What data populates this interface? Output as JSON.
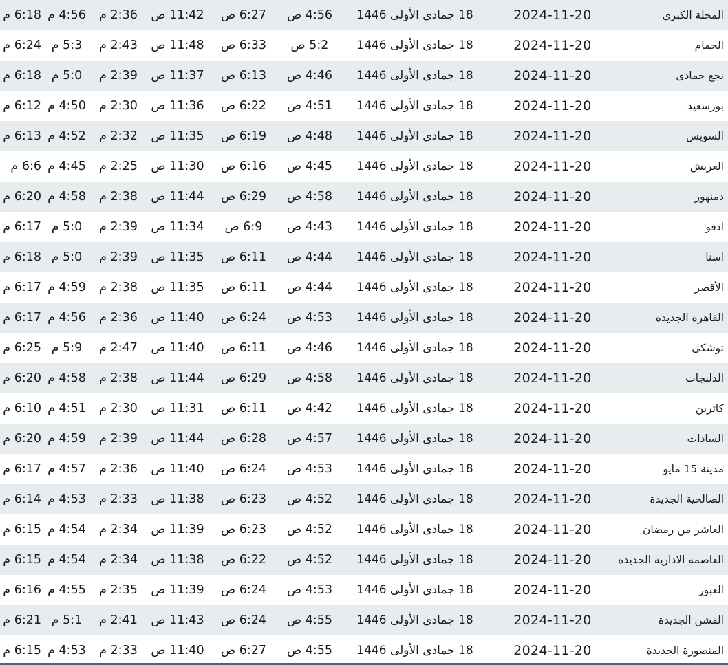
{
  "rows": [
    {
      "city": "المحلة الكبرى",
      "gregorian": "2024-11-20",
      "hijri": "18 جمادى الأولى 1446",
      "fajr": "4:56 ص",
      "sunrise": "6:27 ص",
      "dhuhr": "11:42 ص",
      "asr": "2:36 م",
      "maghrib": "4:56 م",
      "isha": "6:18 م"
    },
    {
      "city": "الحمام",
      "gregorian": "2024-11-20",
      "hijri": "18 جمادى الأولى 1446",
      "fajr": "5:2 ص",
      "sunrise": "6:33 ص",
      "dhuhr": "11:48 ص",
      "asr": "2:43 م",
      "maghrib": "5:3 م",
      "isha": "6:24 م"
    },
    {
      "city": "نجع حمادى",
      "gregorian": "2024-11-20",
      "hijri": "18 جمادى الأولى 1446",
      "fajr": "4:46 ص",
      "sunrise": "6:13 ص",
      "dhuhr": "11:37 ص",
      "asr": "2:39 م",
      "maghrib": "5:0 م",
      "isha": "6:18 م"
    },
    {
      "city": "بورسعيد",
      "gregorian": "2024-11-20",
      "hijri": "18 جمادى الأولى 1446",
      "fajr": "4:51 ص",
      "sunrise": "6:22 ص",
      "dhuhr": "11:36 ص",
      "asr": "2:30 م",
      "maghrib": "4:50 م",
      "isha": "6:12 م"
    },
    {
      "city": "السويس",
      "gregorian": "2024-11-20",
      "hijri": "18 جمادى الأولى 1446",
      "fajr": "4:48 ص",
      "sunrise": "6:19 ص",
      "dhuhr": "11:35 ص",
      "asr": "2:32 م",
      "maghrib": "4:52 م",
      "isha": "6:13 م"
    },
    {
      "city": "العريش",
      "gregorian": "2024-11-20",
      "hijri": "18 جمادى الأولى 1446",
      "fajr": "4:45 ص",
      "sunrise": "6:16 ص",
      "dhuhr": "11:30 ص",
      "asr": "2:25 م",
      "maghrib": "4:45 م",
      "isha": "6:6 م"
    },
    {
      "city": "دمنهور",
      "gregorian": "2024-11-20",
      "hijri": "18 جمادى الأولى 1446",
      "fajr": "4:58 ص",
      "sunrise": "6:29 ص",
      "dhuhr": "11:44 ص",
      "asr": "2:38 م",
      "maghrib": "4:58 م",
      "isha": "6:20 م"
    },
    {
      "city": "ادفو",
      "gregorian": "2024-11-20",
      "hijri": "18 جمادى الأولى 1446",
      "fajr": "4:43 ص",
      "sunrise": "6:9 ص",
      "dhuhr": "11:34 ص",
      "asr": "2:39 م",
      "maghrib": "5:0 م",
      "isha": "6:17 م"
    },
    {
      "city": "اسنا",
      "gregorian": "2024-11-20",
      "hijri": "18 جمادى الأولى 1446",
      "fajr": "4:44 ص",
      "sunrise": "6:11 ص",
      "dhuhr": "11:35 ص",
      "asr": "2:39 م",
      "maghrib": "5:0 م",
      "isha": "6:18 م"
    },
    {
      "city": "الأقصر",
      "gregorian": "2024-11-20",
      "hijri": "18 جمادى الأولى 1446",
      "fajr": "4:44 ص",
      "sunrise": "6:11 ص",
      "dhuhr": "11:35 ص",
      "asr": "2:38 م",
      "maghrib": "4:59 م",
      "isha": "6:17 م"
    },
    {
      "city": "القاهرة الجديدة",
      "gregorian": "2024-11-20",
      "hijri": "18 جمادى الأولى 1446",
      "fajr": "4:53 ص",
      "sunrise": "6:24 ص",
      "dhuhr": "11:40 ص",
      "asr": "2:36 م",
      "maghrib": "4:56 م",
      "isha": "6:17 م"
    },
    {
      "city": "توشكى",
      "gregorian": "2024-11-20",
      "hijri": "18 جمادى الأولى 1446",
      "fajr": "4:46 ص",
      "sunrise": "6:11 ص",
      "dhuhr": "11:40 ص",
      "asr": "2:47 م",
      "maghrib": "5:9 م",
      "isha": "6:25 م"
    },
    {
      "city": "الدلنجات",
      "gregorian": "2024-11-20",
      "hijri": "18 جمادى الأولى 1446",
      "fajr": "4:58 ص",
      "sunrise": "6:29 ص",
      "dhuhr": "11:44 ص",
      "asr": "2:38 م",
      "maghrib": "4:58 م",
      "isha": "6:20 م"
    },
    {
      "city": "كاترين",
      "gregorian": "2024-11-20",
      "hijri": "18 جمادى الأولى 1446",
      "fajr": "4:42 ص",
      "sunrise": "6:11 ص",
      "dhuhr": "11:31 ص",
      "asr": "2:30 م",
      "maghrib": "4:51 م",
      "isha": "6:10 م"
    },
    {
      "city": "السادات",
      "gregorian": "2024-11-20",
      "hijri": "18 جمادى الأولى 1446",
      "fajr": "4:57 ص",
      "sunrise": "6:28 ص",
      "dhuhr": "11:44 ص",
      "asr": "2:39 م",
      "maghrib": "4:59 م",
      "isha": "6:20 م"
    },
    {
      "city": "مدينة 15 مايو",
      "gregorian": "2024-11-20",
      "hijri": "18 جمادى الأولى 1446",
      "fajr": "4:53 ص",
      "sunrise": "6:24 ص",
      "dhuhr": "11:40 ص",
      "asr": "2:36 م",
      "maghrib": "4:57 م",
      "isha": "6:17 م"
    },
    {
      "city": "الصالحية الجديدة",
      "gregorian": "2024-11-20",
      "hijri": "18 جمادى الأولى 1446",
      "fajr": "4:52 ص",
      "sunrise": "6:23 ص",
      "dhuhr": "11:38 ص",
      "asr": "2:33 م",
      "maghrib": "4:53 م",
      "isha": "6:14 م"
    },
    {
      "city": "العاشر من رمضان",
      "gregorian": "2024-11-20",
      "hijri": "18 جمادى الأولى 1446",
      "fajr": "4:52 ص",
      "sunrise": "6:23 ص",
      "dhuhr": "11:39 ص",
      "asr": "2:34 م",
      "maghrib": "4:54 م",
      "isha": "6:15 م"
    },
    {
      "city": "العاصمة الادارية الجديدة",
      "gregorian": "2024-11-20",
      "hijri": "18 جمادى الأولى 1446",
      "fajr": "4:52 ص",
      "sunrise": "6:22 ص",
      "dhuhr": "11:38 ص",
      "asr": "2:34 م",
      "maghrib": "4:54 م",
      "isha": "6:15 م"
    },
    {
      "city": "العبور",
      "gregorian": "2024-11-20",
      "hijri": "18 جمادى الأولى 1446",
      "fajr": "4:53 ص",
      "sunrise": "6:24 ص",
      "dhuhr": "11:39 ص",
      "asr": "2:35 م",
      "maghrib": "4:55 م",
      "isha": "6:16 م"
    },
    {
      "city": "الفشن الجديدة",
      "gregorian": "2024-11-20",
      "hijri": "18 جمادى الأولى 1446",
      "fajr": "4:55 ص",
      "sunrise": "6:24 ص",
      "dhuhr": "11:43 ص",
      "asr": "2:41 م",
      "maghrib": "5:1 م",
      "isha": "6:21 م"
    },
    {
      "city": "المنصورة الجديدة",
      "gregorian": "2024-11-20",
      "hijri": "18 جمادى الأولى 1446",
      "fajr": "4:55 ص",
      "sunrise": "6:27 ص",
      "dhuhr": "11:40 ص",
      "asr": "2:33 م",
      "maghrib": "4:53 م",
      "isha": "6:15 م"
    }
  ]
}
